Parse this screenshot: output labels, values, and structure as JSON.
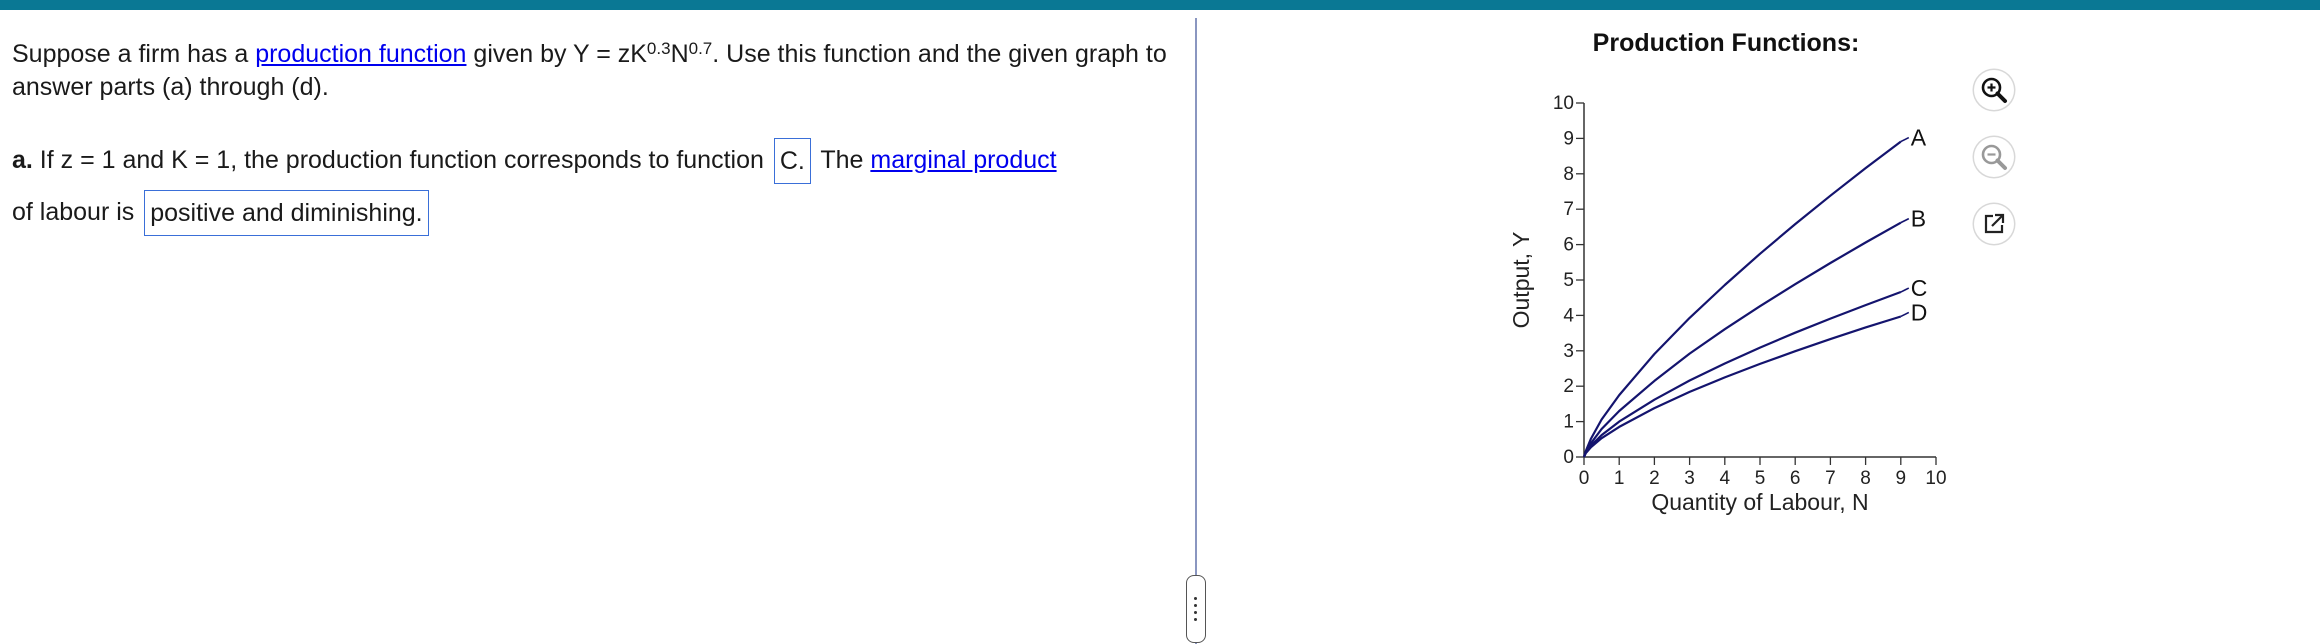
{
  "intro": {
    "before_link": "Suppose a firm has a ",
    "link": "production function",
    "after_link": " given by Y = zK",
    "exp_k": "0.3",
    "n_var": "N",
    "exp_n": "0.7",
    "after_formula": ". Use this function and the given graph to answer parts (a) through (d)."
  },
  "question_a": {
    "label": "a.",
    "text1": " If z = 1 and K = 1, the production function corresponds to function",
    "answer1": "C.",
    "text2": "The ",
    "link2": "marginal product",
    "text3": "of labour is",
    "answer2": "positive and diminishing."
  },
  "graph": {
    "title": "Production Functions:",
    "colors": {
      "curve": "#14146e",
      "axis": "#333333",
      "accent": "#0a7894"
    }
  },
  "chart_data": {
    "type": "line",
    "title": "Production Functions:",
    "xlabel": "Quantity of Labour, N",
    "ylabel": "Output, Y",
    "xlim": [
      0,
      10
    ],
    "ylim": [
      0,
      10
    ],
    "x_ticks": [
      "0",
      "1",
      "2",
      "3",
      "4",
      "5",
      "6",
      "7",
      "8",
      "9",
      "10"
    ],
    "y_ticks": [
      "0",
      "1",
      "2",
      "3",
      "4",
      "5",
      "6",
      "7",
      "8",
      "9",
      "10"
    ],
    "x": [
      0,
      0.05,
      0.2,
      0.5,
      1,
      2,
      3,
      4,
      5,
      6,
      7,
      8,
      9
    ],
    "series": [
      {
        "name": "A",
        "values": [
          0,
          0.17,
          0.52,
          1.06,
          1.75,
          2.91,
          3.93,
          4.86,
          5.74,
          6.58,
          7.38,
          8.16,
          8.91
        ]
      },
      {
        "name": "B",
        "values": [
          0,
          0.13,
          0.39,
          0.79,
          1.3,
          2.15,
          2.92,
          3.61,
          4.26,
          4.88,
          5.48,
          6.06,
          6.62
        ]
      },
      {
        "name": "C",
        "values": [
          0,
          0.12,
          0.32,
          0.62,
          1.0,
          1.62,
          2.16,
          2.64,
          3.09,
          3.51,
          3.91,
          4.29,
          4.66
        ]
      },
      {
        "name": "D",
        "values": [
          0,
          0.11,
          0.28,
          0.53,
          0.85,
          1.38,
          1.84,
          2.25,
          2.63,
          2.99,
          3.33,
          3.66,
          3.97
        ]
      }
    ]
  },
  "toolbar": {
    "zoom_in_icon": "zoom-in-icon",
    "zoom_out_icon": "zoom-out-icon",
    "popout_icon": "popout-icon"
  }
}
